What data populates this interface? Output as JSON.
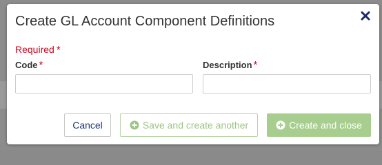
{
  "dialog": {
    "title": "Create GL Account Component Definitions",
    "close_icon": "close-icon"
  },
  "form": {
    "required_text": "Required",
    "required_marker": "*",
    "fields": {
      "code": {
        "label": "Code",
        "value": "",
        "placeholder": ""
      },
      "description": {
        "label": "Description",
        "value": "",
        "placeholder": ""
      }
    }
  },
  "buttons": {
    "cancel_label": "Cancel",
    "save_another_label": "Save and create another",
    "create_close_label": "Create and close",
    "save_another_icon": "plus-circle-icon",
    "create_close_icon": "plus-circle-icon"
  },
  "colors": {
    "required": "#d0021b",
    "cancel_text": "#1a3a78",
    "primary_disabled": "#a7ce8e",
    "secondary_disabled_text": "#9cc584",
    "close_icon": "#1a2a6c"
  }
}
